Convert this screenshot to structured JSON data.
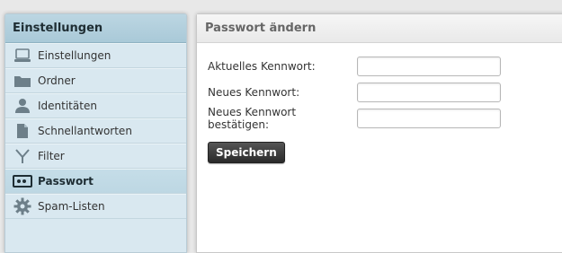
{
  "sidebar": {
    "title": "Einstellungen",
    "items": [
      {
        "label": "Einstellungen",
        "icon": "laptop-icon"
      },
      {
        "label": "Ordner",
        "icon": "folder-icon"
      },
      {
        "label": "Identitäten",
        "icon": "person-icon"
      },
      {
        "label": "Schnellantworten",
        "icon": "document-icon"
      },
      {
        "label": "Filter",
        "icon": "filter-icon"
      },
      {
        "label": "Passwort",
        "icon": "password-icon",
        "selected": true
      },
      {
        "label": "Spam-Listen",
        "icon": "gear-icon"
      }
    ]
  },
  "panel": {
    "title": "Passwort ändern",
    "fields": {
      "current_label": "Aktuelles Kennwort:",
      "current_value": "",
      "new_label": "Neues Kennwort:",
      "new_value": "",
      "confirm_label": "Neues Kennwort bestätigen:",
      "confirm_value": ""
    },
    "save_label": "Speichern"
  },
  "colors": {
    "sidebar_bg": "#d9e8f0",
    "sidebar_header_bg": "#a9c9d8",
    "selected_bg": "#bdd7e3",
    "button_bg": "#2a2a2a",
    "icon_color": "#7a8a94"
  }
}
